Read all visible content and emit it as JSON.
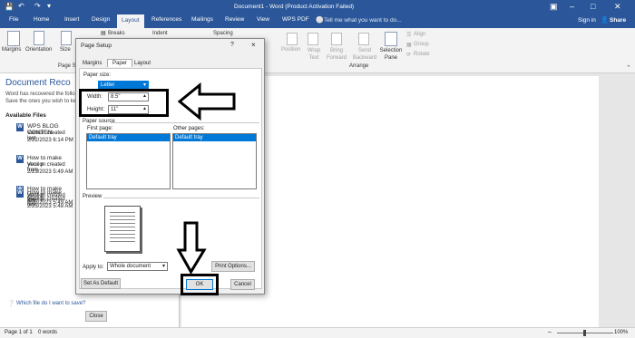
{
  "window": {
    "title": "Document1 - Word (Product Activation Failed)",
    "search_placeholder": "Tell me what you want to do...",
    "sign_in": "Sign in",
    "share": "Share"
  },
  "tabs": [
    "File",
    "Home",
    "Insert",
    "Design",
    "Layout",
    "References",
    "Mailings",
    "Review",
    "View",
    "WPS PDF"
  ],
  "ribbon": {
    "margins": "Margins",
    "orientation": "Orientation",
    "size": "Size",
    "breaks": "Breaks",
    "indent": "Indent",
    "spacing": "Spacing",
    "page_setup_group": "Page S",
    "position": "Position",
    "wrap_text": "Wrap Text",
    "bring_forward": "Bring Forward",
    "send_backward": "Send Backward",
    "selection_pane": "Selection Pane",
    "align": "Align",
    "group": "Group",
    "rotate": "Rotate",
    "arrange_group": "Arrange"
  },
  "recovery": {
    "title": "Document Reco",
    "desc_line1": "Word has recovered the follo",
    "desc_line2": "Save the ones you wish to ke",
    "available_files": "Available Files",
    "files": [
      {
        "name": "WPS BLOG CONTEN",
        "line2": "Version created last",
        "date": "2/22/2023 6:14 PM"
      },
      {
        "name": "How to make your p",
        "line2": "Version created from",
        "date": "2/23/2023 5:49 AM"
      },
      {
        "name": "How to make your p",
        "line2": "Version created last",
        "date": "2/23/2023 5:49 AM"
      },
      {
        "name": "How to make your p",
        "line2": "Version created last",
        "date": "2/23/2023 5:48 AM"
      }
    ],
    "help_link": "Which file do I want to save?",
    "close": "Close"
  },
  "dialog": {
    "title": "Page Setup",
    "help": "?",
    "close": "×",
    "tabs": [
      "Margins",
      "Paper",
      "Layout"
    ],
    "paper_size_label": "Paper size:",
    "paper_size_value": "Letter",
    "width_label": "Width:",
    "width_value": "8.5\"",
    "height_label": "Height:",
    "height_value": "11\"",
    "paper_source_label": "Paper source",
    "first_page_label": "First page:",
    "first_page_value": "Default tray",
    "other_pages_label": "Other pages:",
    "other_pages_value": "Default tray",
    "preview_label": "Preview",
    "apply_to_label": "Apply to:",
    "apply_to_value": "Whole document",
    "print_options": "Print Options...",
    "set_as_default": "Set As Default",
    "ok": "OK",
    "cancel": "Cancel"
  },
  "status": {
    "page": "Page 1 of 1",
    "words": "0 words",
    "zoom": "100%"
  },
  "colors": {
    "word_blue": "#2b579a",
    "selection": "#0078d7"
  }
}
